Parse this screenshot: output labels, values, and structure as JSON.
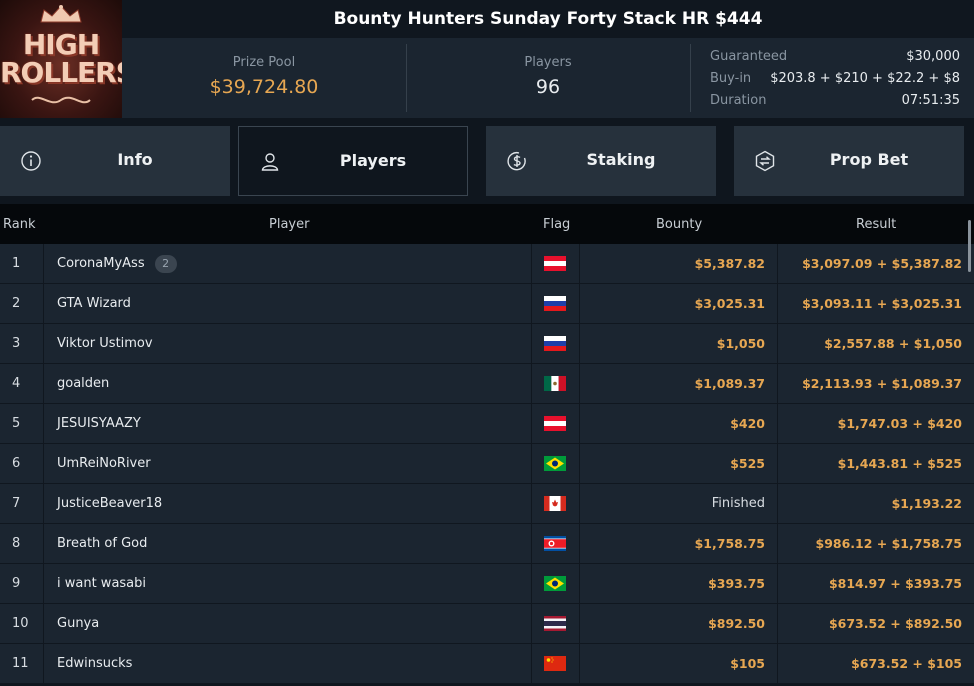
{
  "tournament": {
    "title": "Bounty Hunters Sunday Forty Stack HR $444",
    "logo_text_1": "HIGH",
    "logo_text_2": "ROLLERS"
  },
  "stats": {
    "prize_pool_label": "Prize Pool",
    "prize_pool_value": "$39,724.80",
    "players_label": "Players",
    "players_value": "96",
    "guaranteed_label": "Guaranteed",
    "guaranteed_value": "$30,000",
    "buyin_label": "Buy-in",
    "buyin_value": "$203.8 + $210 + $22.2 + $8",
    "duration_label": "Duration",
    "duration_value": "07:51:35"
  },
  "tabs": [
    {
      "label": "Info",
      "icon": "info-icon",
      "active": false
    },
    {
      "label": "Players",
      "icon": "user-icon",
      "active": true
    },
    {
      "label": "Staking",
      "icon": "dollar-coin-icon",
      "active": false
    },
    {
      "label": "Prop Bet",
      "icon": "prop-bet-icon",
      "active": false
    }
  ],
  "table": {
    "columns": {
      "rank": "Rank",
      "player": "Player",
      "flag": "Flag",
      "bounty": "Bounty",
      "result": "Result"
    },
    "rows": [
      {
        "rank": "1",
        "player": "CoronaMyAss",
        "badge": "2",
        "flag": "austria",
        "bounty": "$5,387.82",
        "result": "$3,097.09 + $5,387.82"
      },
      {
        "rank": "2",
        "player": "GTA Wizard",
        "flag": "russia",
        "bounty": "$3,025.31",
        "result": "$3,093.11 + $3,025.31"
      },
      {
        "rank": "3",
        "player": "Viktor Ustimov",
        "flag": "russia",
        "bounty": "$1,050",
        "result": "$2,557.88 + $1,050"
      },
      {
        "rank": "4",
        "player": "goalden",
        "flag": "mexico",
        "bounty": "$1,089.37",
        "result": "$2,113.93 + $1,089.37"
      },
      {
        "rank": "5",
        "player": "JESUISYAAZY",
        "flag": "austria",
        "bounty": "$420",
        "result": "$1,747.03 + $420"
      },
      {
        "rank": "6",
        "player": "UmReiNoRiver",
        "flag": "brazil",
        "bounty": "$525",
        "result": "$1,443.81 + $525"
      },
      {
        "rank": "7",
        "player": "JusticeBeaver18",
        "flag": "canada",
        "bounty": "Finished",
        "result": "$1,193.22"
      },
      {
        "rank": "8",
        "player": "Breath of God",
        "flag": "north-korea",
        "bounty": "$1,758.75",
        "result": "$986.12 + $1,758.75"
      },
      {
        "rank": "9",
        "player": "i want wasabi",
        "flag": "brazil",
        "bounty": "$393.75",
        "result": "$814.97 + $393.75"
      },
      {
        "rank": "10",
        "player": "Gunya",
        "flag": "thailand",
        "bounty": "$892.50",
        "result": "$673.52 + $892.50"
      },
      {
        "rank": "11",
        "player": "Edwinsucks",
        "flag": "china",
        "bounty": "$105",
        "result": "$673.52 + $105"
      }
    ]
  },
  "colors": {
    "accent": "#e7a752",
    "panel": "#1b2530",
    "tab": "#26313c",
    "background": "#0f161e"
  }
}
